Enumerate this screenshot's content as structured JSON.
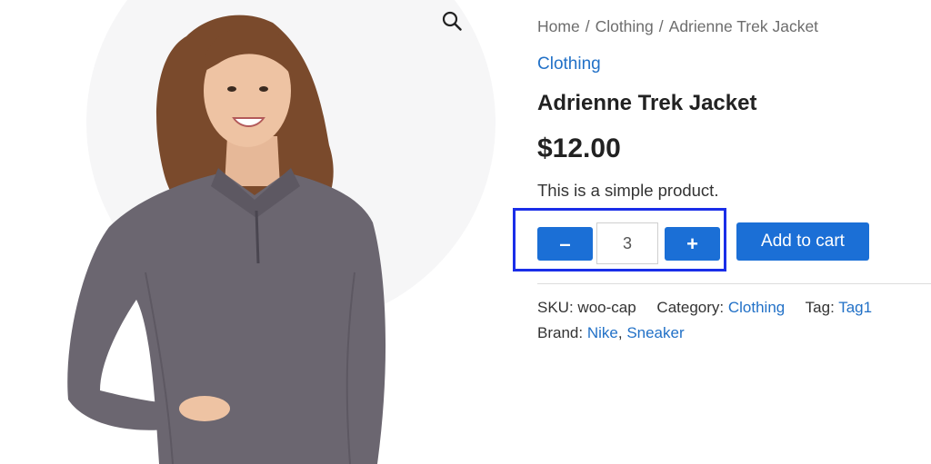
{
  "gallery": {
    "zoom_icon": "magnifier-icon",
    "image_alt": "Adrienne Trek Jacket product photo"
  },
  "breadcrumb": {
    "items": [
      "Home",
      "Clothing",
      "Adrienne Trek Jacket"
    ],
    "separator": "/"
  },
  "product": {
    "category_link": "Clothing",
    "title": "Adrienne Trek Jacket",
    "price": "$12.00",
    "short_description": "This is a simple product."
  },
  "cart_form": {
    "minus_label": "–",
    "quantity": "3",
    "plus_label": "+",
    "add_to_cart_label": "Add to cart"
  },
  "meta": {
    "sku_label": "SKU:",
    "sku_value": "woo-cap",
    "category_label": "Category:",
    "category_value": "Clothing",
    "tag_label": "Tag:",
    "tag_value": "Tag1",
    "brand_label": "Brand:",
    "brands": [
      "Nike",
      "Sneaker"
    ],
    "brand_separator": ","
  },
  "colors": {
    "accent": "#1b6fd6",
    "link": "#2271c7",
    "highlight_outline": "#1a2ee8",
    "jacket": "#6b6670"
  }
}
